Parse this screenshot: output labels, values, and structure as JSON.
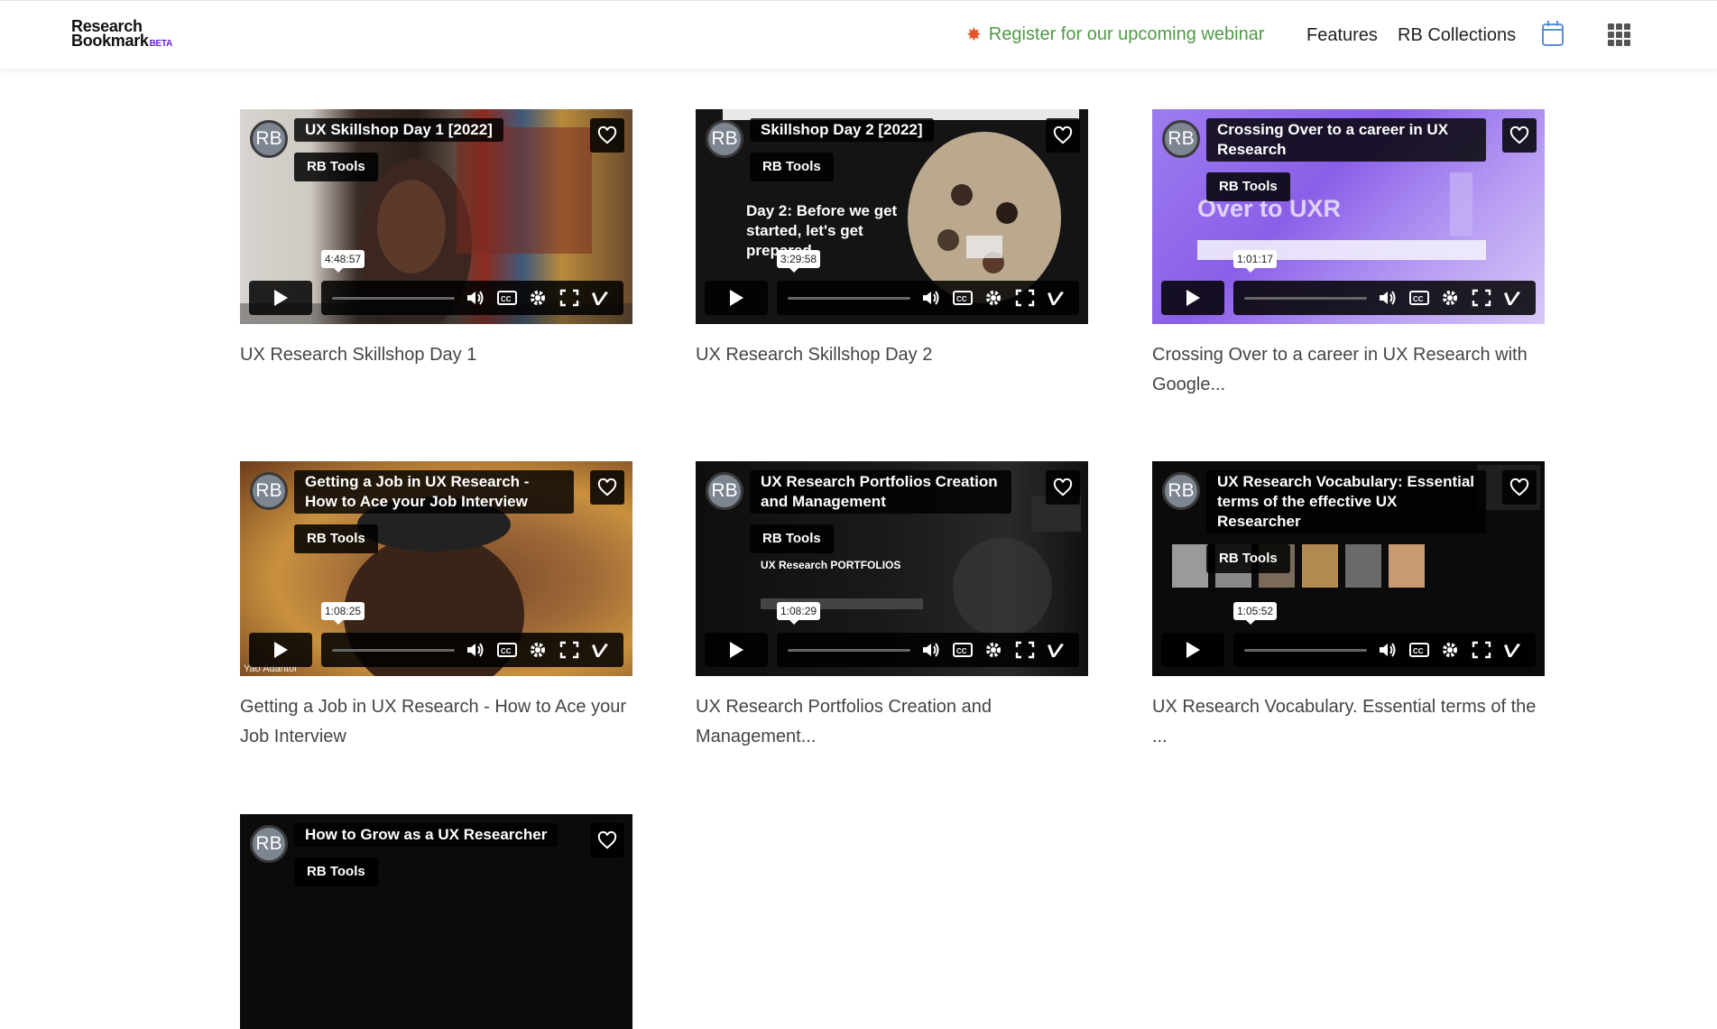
{
  "logo": {
    "line1": "Research",
    "line2": "Bookmark",
    "badge": "BETA"
  },
  "nav": {
    "webinar_icon": "burst-icon",
    "webinar_label": "Register for our upcoming webinar",
    "features_label": "Features",
    "collections_label": "RB Collections",
    "calendar_icon": "calendar-icon",
    "apps_icon": "grid-icon"
  },
  "colors": {
    "webinar_text": "#4f9a45",
    "beta": "#6a1bd6",
    "calendar": "#5b8fd8"
  },
  "videos": [
    {
      "overlay_title": "UX Skillshop Day 1 [2022]",
      "tag": "RB Tools",
      "duration": "4:48:57",
      "title": "UX Research Skillshop Day 1",
      "avatar": "RB"
    },
    {
      "overlay_title": "Skillshop Day 2 [2022]",
      "tag": "RB Tools",
      "duration": "3:29:58",
      "title": "UX Research Skillshop Day 2",
      "avatar": "RB",
      "slide_text": "Day 2: Before we get started, let's get prepared"
    },
    {
      "overlay_title": "Crossing Over to a career in UX Research",
      "tag": "RB Tools",
      "duration": "1:01:17",
      "title": "Crossing Over to a career in UX Research with Google...",
      "avatar": "RB",
      "slide_text": "Over to UXR"
    },
    {
      "overlay_title": "Getting a Job in UX Research - How to Ace your Job Interview",
      "tag": "RB Tools",
      "duration": "1:08:25",
      "title": "Getting a Job in UX Research - How to Ace your Job Interview",
      "avatar": "RB",
      "caption": "Yao Adantor"
    },
    {
      "overlay_title": "UX Research Portfolios Creation and Management",
      "tag": "RB Tools",
      "duration": "1:08:29",
      "title": "UX Research Portfolios Creation and Management...",
      "avatar": "RB",
      "slide_text": "UX Research PORTFOLIOS"
    },
    {
      "overlay_title": "UX Research Vocabulary: Essential terms of the effective UX Researcher",
      "tag": "RB Tools",
      "duration": "1:05:52",
      "title": "UX Research Vocabulary. Essential terms of the ...",
      "avatar": "RB"
    },
    {
      "overlay_title": "How to Grow as a UX Researcher",
      "tag": "RB Tools",
      "avatar": "RB"
    }
  ]
}
